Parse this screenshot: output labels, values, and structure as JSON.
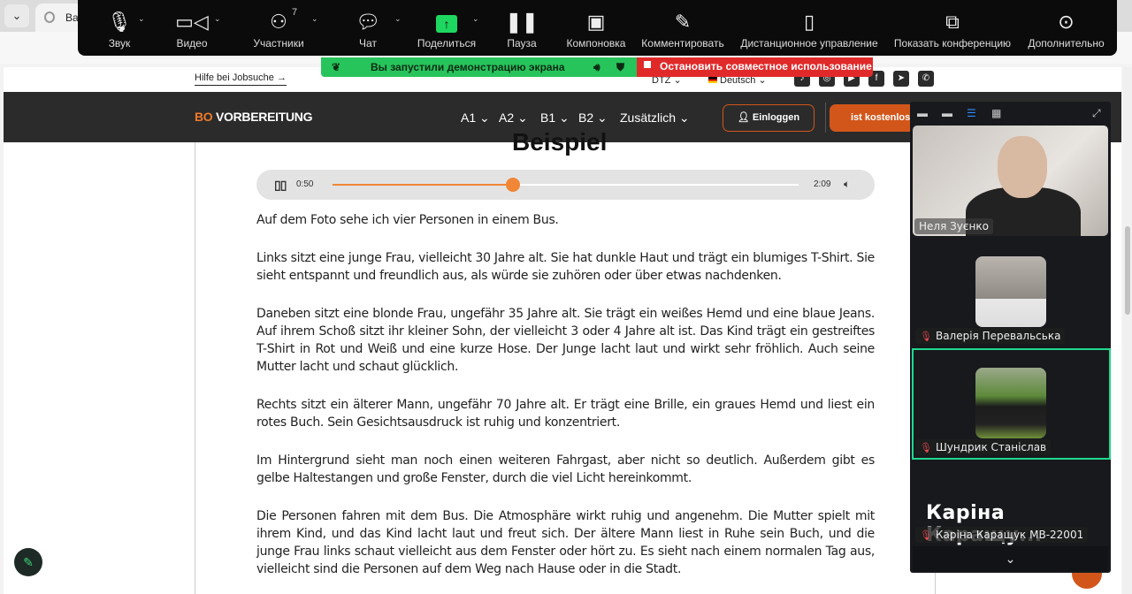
{
  "browser": {
    "tab_title": "Ba",
    "back": "←",
    "reload": "↻",
    "tab_menu": "⌄"
  },
  "site": {
    "top_link": "Hilfe bei Jobsuche →",
    "exam_select": "DTZ ⌄",
    "language": "Deutsch ⌄",
    "socials": [
      "tiktok-icon",
      "instagram-icon",
      "youtube-icon",
      "facebook-icon",
      "telegram-icon",
      "whatsapp-icon"
    ],
    "logo_accent": "BO",
    "logo_rest": " VORBEREITUNG",
    "menu": [
      "A1 ⌄",
      "A2 ⌄",
      "B1 ⌄",
      "B2 ⌄",
      "Zusätzlich ⌄"
    ],
    "login": "Einloggen",
    "free": "ist kostenlos",
    "heading": "Beispiel",
    "player": {
      "current": "0:50",
      "duration": "2:09",
      "progress": 0.388
    },
    "paragraphs": [
      "Auf dem Foto sehe ich vier Personen in einem Bus.",
      "Links sitzt eine junge Frau, vielleicht 30 Jahre alt. Sie hat dunkle Haut und trägt ein blumiges T-Shirt. Sie sieht entspannt und freundlich aus, als würde sie zuhören oder über etwas nachdenken.",
      "Daneben sitzt eine blonde Frau, ungefähr 35 Jahre alt. Sie trägt ein weißes Hemd und eine blaue Jeans. Auf ihrem Schoß sitzt ihr kleiner Sohn, der vielleicht 3 oder 4 Jahre alt ist. Das Kind trägt ein gestreiftes T-Shirt in Rot und Weiß und eine kurze Hose. Der Junge lacht laut und wirkt sehr fröhlich. Auch seine Mutter lacht und schaut glücklich.",
      "Rechts sitzt ein älterer Mann, ungefähr 70 Jahre alt. Er trägt eine Brille, ein graues Hemd und liest ein rotes Buch. Sein Gesichtsausdruck ist ruhig und konzentriert.",
      "Im Hintergrund sieht man noch einen weiteren Fahrgast, aber nicht so deutlich. Außerdem gibt es gelbe Haltestangen und große Fenster, durch die viel Licht hereinkommt.",
      "Die Personen fahren mit dem Bus. Die Atmosphäre wirkt ruhig und angenehm. Die Mutter spielt mit ihrem Kind, und das Kind lacht laut und freut sich. Der ältere Mann liest in Ruhe sein Buch, und die junge Frau links schaut vielleicht aus dem Fenster oder hört zu. Es sieht nach einem normalen Tag aus, vielleicht sind die Personen auf dem Weg nach Hause oder in die Stadt."
    ]
  },
  "zoom": {
    "toolbar": [
      {
        "label": "Звук",
        "icon": "microphone-icon"
      },
      {
        "label": "Видео",
        "icon": "video-icon"
      },
      {
        "label": "Участники",
        "icon": "participants-icon",
        "badge": "7"
      },
      {
        "label": "Чат",
        "icon": "chat-icon"
      },
      {
        "label": "Поделиться",
        "icon": "share-icon"
      },
      {
        "label": "Пауза",
        "icon": "pause-icon"
      },
      {
        "label": "Компоновка",
        "icon": "layout-icon"
      },
      {
        "label": "Комментировать",
        "icon": "annotate-icon"
      },
      {
        "label": "Дистанционное управление",
        "icon": "mouse-icon"
      },
      {
        "label": "Показать конференцию",
        "icon": "show-meeting-icon"
      },
      {
        "label": "Дополнительно",
        "icon": "more-icon"
      }
    ],
    "share_banner": "Вы запустили демонстрацию экрана",
    "stop_share": "Остановить совместное использование",
    "participants": [
      {
        "name": "Неля Зуєнко"
      },
      {
        "name": "Валерія Перевальська",
        "muted": true
      },
      {
        "name": "Шундрик Станіслав",
        "muted": true
      },
      {
        "name": "Каріна Каращук МВ-22001",
        "muted": true,
        "display": "Каріна  Каращу..."
      }
    ],
    "colors": {
      "share_green": "#27c45c",
      "stop_red": "#e02a2a",
      "accent": "#d2561a",
      "active_speaker": "#1fd88f"
    }
  }
}
